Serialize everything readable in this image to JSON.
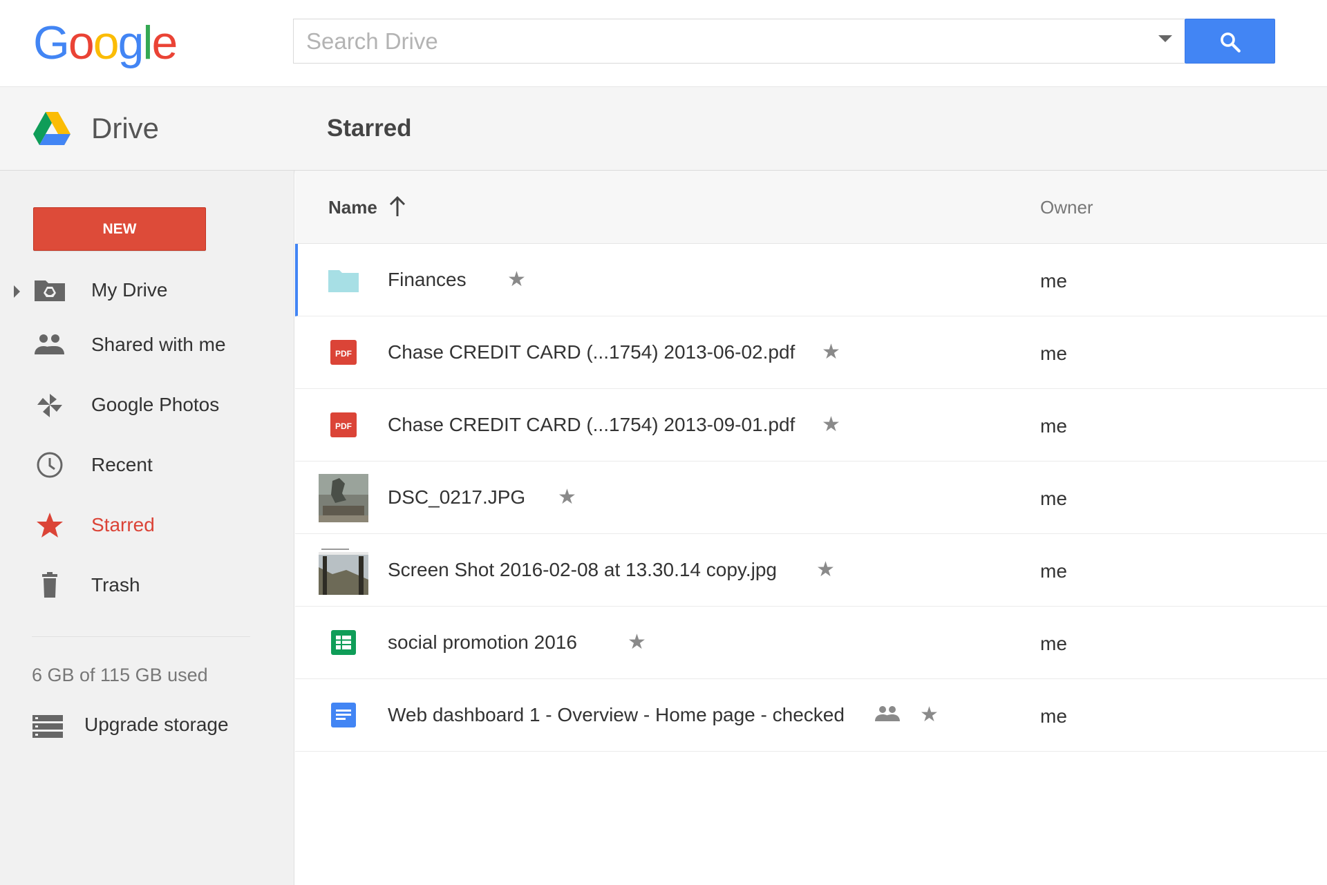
{
  "brand": {
    "logo_letters": [
      "G",
      "o",
      "o",
      "g",
      "l",
      "e"
    ],
    "logo_colors": [
      "#4285f4",
      "#ea4335",
      "#fbbc05",
      "#4285f4",
      "#34a853",
      "#ea4335"
    ]
  },
  "search": {
    "placeholder": "Search Drive",
    "value": ""
  },
  "header": {
    "app_label": "Drive",
    "section_title": "Starred"
  },
  "sidebar": {
    "new_label": "NEW",
    "items": [
      {
        "label": "My Drive",
        "icon": "my-drive-folder-icon",
        "active": false
      },
      {
        "label": "Shared with me",
        "icon": "people-icon",
        "active": false
      },
      {
        "label": "Google Photos",
        "icon": "pinwheel-icon",
        "active": false
      },
      {
        "label": "Recent",
        "icon": "clock-icon",
        "active": false
      },
      {
        "label": "Starred",
        "icon": "star-icon",
        "active": true
      },
      {
        "label": "Trash",
        "icon": "trash-icon",
        "active": false
      }
    ],
    "storage_text": "6 GB of 115 GB used",
    "upgrade_label": "Upgrade storage"
  },
  "file_list": {
    "columns": {
      "name": "Name",
      "owner": "Owner"
    },
    "rows": [
      {
        "name": "Finances",
        "type": "folder",
        "owner": "me",
        "starred": true,
        "shared": false,
        "selected": true
      },
      {
        "name": "Chase CREDIT CARD (...1754) 2013-06-02.pdf",
        "type": "pdf",
        "owner": "me",
        "starred": true,
        "shared": false,
        "selected": false
      },
      {
        "name": "Chase CREDIT CARD (...1754) 2013-09-01.pdf",
        "type": "pdf",
        "owner": "me",
        "starred": true,
        "shared": false,
        "selected": false
      },
      {
        "name": "DSC_0217.JPG",
        "type": "image",
        "owner": "me",
        "starred": true,
        "shared": false,
        "selected": false
      },
      {
        "name": "Screen Shot 2016-02-08 at 13.30.14 copy.jpg",
        "type": "image",
        "owner": "me",
        "starred": true,
        "shared": false,
        "selected": false
      },
      {
        "name": "social promotion 2016",
        "type": "spreadsheet",
        "owner": "me",
        "starred": true,
        "shared": false,
        "selected": false
      },
      {
        "name": "Web dashboard 1 - Overview - Home page - checked",
        "type": "document",
        "owner": "me",
        "starred": true,
        "shared": true,
        "selected": false
      }
    ],
    "pdf_badge": "PDF"
  },
  "colors": {
    "accent_blue": "#4285f4",
    "new_button_red": "#dd4b39",
    "starred_red": "#db4437",
    "folder_teal": "#a7dfe5",
    "sheets_green": "#0f9d58",
    "docs_blue": "#4285f4"
  }
}
